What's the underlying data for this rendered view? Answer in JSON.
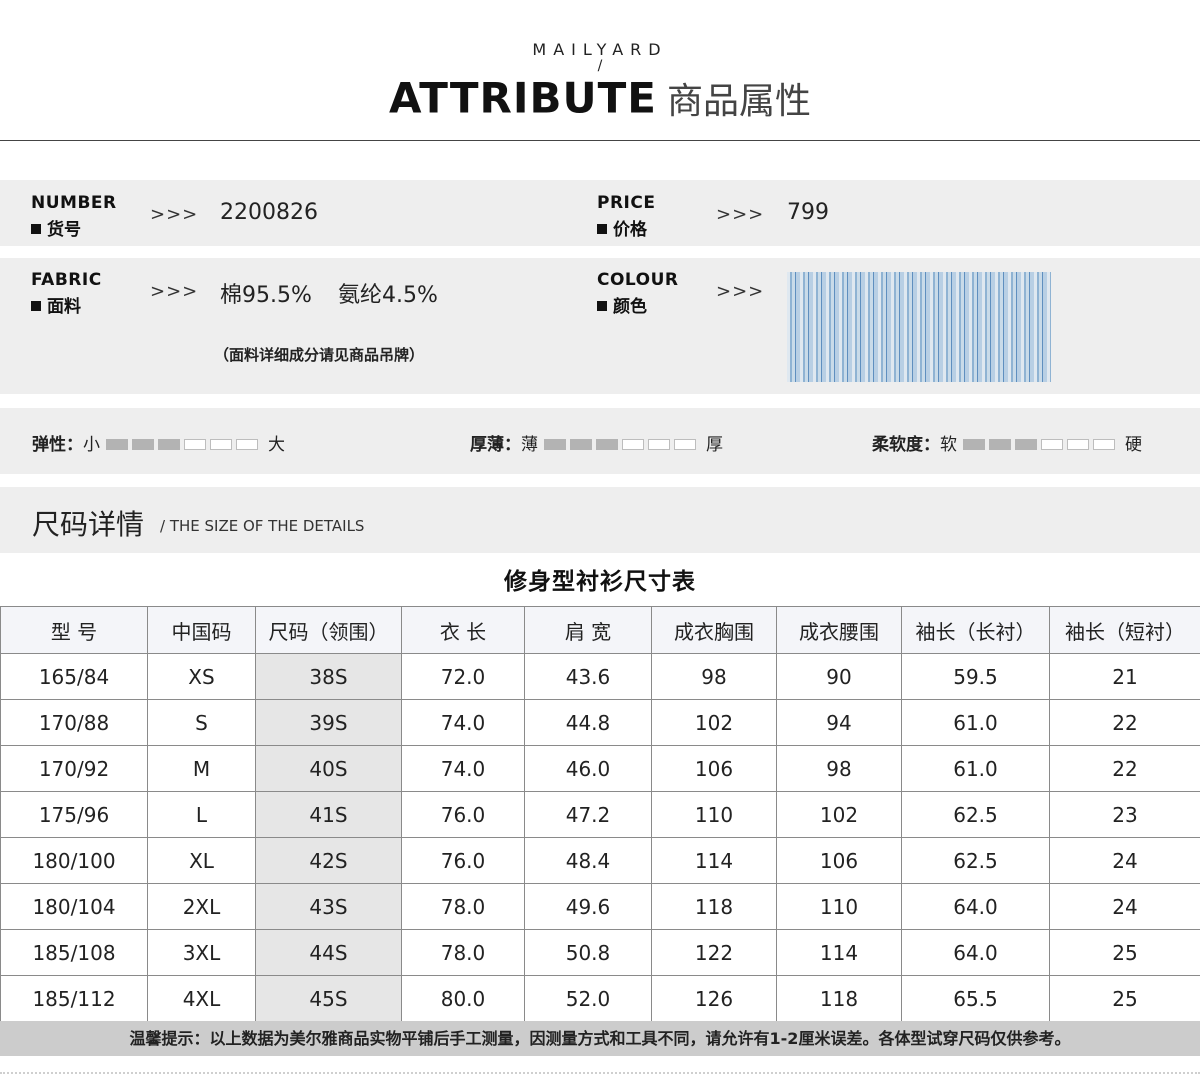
{
  "header": {
    "brand": "MAILYARD",
    "slash": "/",
    "title_en": "ATTRIBUTE",
    "title_cn": "商品属性"
  },
  "attributes": {
    "arrow": ">>>",
    "number": {
      "en": "NUMBER",
      "cn": "货号",
      "value": "2200826"
    },
    "price": {
      "en": "PRICE",
      "cn": "价格",
      "value": "799"
    },
    "fabric": {
      "en": "FABRIC",
      "cn": "面料",
      "value1": "棉95.5%",
      "value2": "氨纶4.5%",
      "note": "（面料详细成分请见商品吊牌）"
    },
    "colour": {
      "en": "COLOUR",
      "cn": "颜色",
      "swatch": "light-blue-stripe",
      "colors": [
        "#dfe8f0",
        "#8fb3d3",
        "#5f8fbf"
      ]
    }
  },
  "ratings": [
    {
      "label": "弹性：",
      "low": "小",
      "high": "大",
      "level": 3,
      "total": 6
    },
    {
      "label": "厚薄：",
      "low": "薄",
      "high": "厚",
      "level": 3,
      "total": 6
    },
    {
      "label": "柔软度：",
      "low": "软",
      "high": "硬",
      "level": 3,
      "total": 6
    }
  ],
  "size_section": {
    "title_cn": "尺码详情",
    "title_en": "/ THE SIZE OF THE DETAILS",
    "table_title": "修身型衬衫尺寸表",
    "headers": [
      "型 号",
      "中国码",
      "尺码（领围）",
      "衣 长",
      "肩 宽",
      "成衣胸围",
      "成衣腰围",
      "袖长（长衬）",
      "袖长（短衬）"
    ],
    "rows": [
      [
        "165/84",
        "XS",
        "38S",
        "72.0",
        "43.6",
        "98",
        "90",
        "59.5",
        "21"
      ],
      [
        "170/88",
        "S",
        "39S",
        "74.0",
        "44.8",
        "102",
        "94",
        "61.0",
        "22"
      ],
      [
        "170/92",
        "M",
        "40S",
        "74.0",
        "46.0",
        "106",
        "98",
        "61.0",
        "22"
      ],
      [
        "175/96",
        "L",
        "41S",
        "76.0",
        "47.2",
        "110",
        "102",
        "62.5",
        "23"
      ],
      [
        "180/100",
        "XL",
        "42S",
        "76.0",
        "48.4",
        "114",
        "106",
        "62.5",
        "24"
      ],
      [
        "180/104",
        "2XL",
        "43S",
        "78.0",
        "49.6",
        "118",
        "110",
        "64.0",
        "24"
      ],
      [
        "185/108",
        "3XL",
        "44S",
        "78.0",
        "50.8",
        "122",
        "114",
        "64.0",
        "25"
      ],
      [
        "185/112",
        "4XL",
        "45S",
        "80.0",
        "52.0",
        "126",
        "118",
        "65.5",
        "25"
      ]
    ],
    "footnote": "温馨提示：以上数据为美尔雅商品实物平铺后手工测量，因测量方式和工具不同，请允许有1-2厘米误差。各体型试穿尺码仅供参考。"
  }
}
